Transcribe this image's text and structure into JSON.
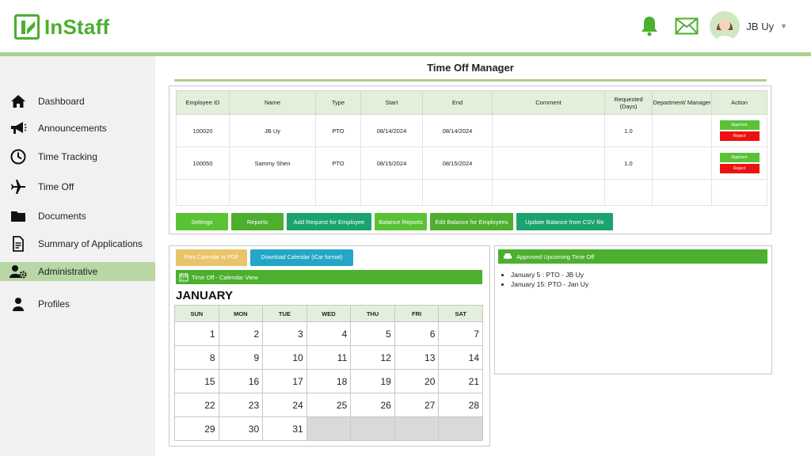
{
  "app": {
    "name": "InStaff"
  },
  "header": {
    "user_name": "JB Uy"
  },
  "sidebar": {
    "items": [
      {
        "label": "Dashboard",
        "icon": "home-icon"
      },
      {
        "label": "Announcements",
        "icon": "megaphone-icon"
      },
      {
        "label": "Time Tracking",
        "icon": "clock-icon"
      },
      {
        "label": "Time Off",
        "icon": "airplane-icon"
      },
      {
        "label": "Documents",
        "icon": "folder-icon"
      },
      {
        "label": "Summary of Applications",
        "icon": "document-icon"
      },
      {
        "label": "Administrative",
        "icon": "user-cog-icon",
        "active": true
      },
      {
        "label": "Profiles",
        "icon": "user-icon"
      }
    ]
  },
  "page": {
    "title": "Time Off Manager"
  },
  "requests": {
    "columns": [
      "Employee ID",
      "Name",
      "Type",
      "Start",
      "End",
      "Comment",
      "Requested (Days)",
      "Department/ Manager",
      "Action"
    ],
    "rows": [
      {
        "id": "100020",
        "name": "JB Uy",
        "type": "PTO",
        "start": "08/14/2024",
        "end": "08/14/2024",
        "comment": "",
        "days": "1.0",
        "dept": ""
      },
      {
        "id": "100050",
        "name": "Sammy Shen",
        "type": "PTO",
        "start": "08/15/2024",
        "end": "08/15/2024",
        "comment": "",
        "days": "1.0",
        "dept": ""
      }
    ],
    "approve_label": "Approve",
    "reject_label": "Reject"
  },
  "actions": {
    "settings": "Settings",
    "reports": "Reports",
    "add_request": "Add Request for Employee",
    "balance_reports": "Balance Reports",
    "edit_balance": "Edit Balance for Employees",
    "update_balance": "Update Balance from CSV file"
  },
  "calendar": {
    "print_pdf": "Print Calendar to PDF",
    "download": "Download Calendar (iCar format)",
    "view_title": "Time Off - Calendar View",
    "month": "JANUARY",
    "weekdays": [
      "SUN",
      "MON",
      "TUE",
      "WED",
      "THU",
      "FRI",
      "SAT"
    ],
    "weeks": [
      [
        "1",
        "2",
        "3",
        "4",
        "5",
        "6",
        "7"
      ],
      [
        "8",
        "9",
        "10",
        "11",
        "12",
        "13",
        "14"
      ],
      [
        "15",
        "16",
        "17",
        "18",
        "19",
        "20",
        "21"
      ],
      [
        "22",
        "23",
        "24",
        "25",
        "26",
        "27",
        "28"
      ],
      [
        "29",
        "30",
        "31",
        "",
        "",
        "",
        ""
      ]
    ]
  },
  "upcoming": {
    "title": "Approved Upcoming Time Off",
    "items": [
      "January 5 : PTO - JB Uy",
      "January 15: PTO - Jan Uy"
    ]
  },
  "colors": {
    "brand_green": "#4caf2e",
    "light_green": "#a9d18e",
    "approve": "#5bc236",
    "reject": "#ee1111",
    "teal": "#1aa36f",
    "yellow": "#e9c46a",
    "cyan": "#23a6c8"
  }
}
